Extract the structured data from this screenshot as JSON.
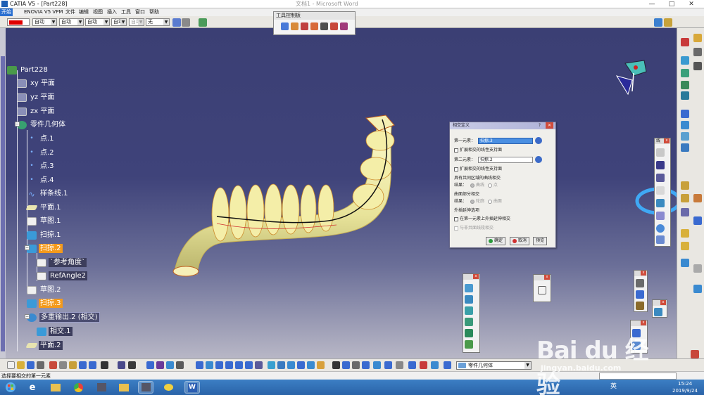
{
  "window": {
    "title": "CATIA V5 - [Part228]",
    "background_title": "文档1 - Microsoft Word",
    "controls": [
      "—",
      "□",
      "✕"
    ]
  },
  "menubar": {
    "items": [
      "开始",
      "ENOVIA V5 VPM",
      "文件",
      "编辑",
      "视图",
      "插入",
      "工具",
      "窗口",
      "帮助"
    ]
  },
  "top_toolbar": {
    "color": "#e00000",
    "combos": [
      "自动",
      "自动",
      "自动",
      "自动",
      "自动",
      "无"
    ]
  },
  "toolbox": {
    "title": "工具控制板"
  },
  "tree": {
    "root": "Part228",
    "items": [
      {
        "label": "xy 平面",
        "icon": "plane-icon"
      },
      {
        "label": "yz 平面",
        "icon": "plane-icon"
      },
      {
        "label": "zx 平面",
        "icon": "plane-icon"
      },
      {
        "label": "零件几何体",
        "icon": "body-icon"
      },
      {
        "label": "点.1",
        "icon": "point-icon"
      },
      {
        "label": "点.2",
        "icon": "point-icon"
      },
      {
        "label": "点.3",
        "icon": "point-icon"
      },
      {
        "label": "点.4",
        "icon": "point-icon"
      },
      {
        "label": "样条线.1",
        "icon": "spline-icon"
      },
      {
        "label": "平面.1",
        "icon": "plane-feature-icon"
      },
      {
        "label": "草图.1",
        "icon": "sketch-icon"
      },
      {
        "label": "扫掠.1",
        "icon": "sweep-icon"
      },
      {
        "label": "扫掠.2",
        "icon": "sweep-icon"
      },
      {
        "label": "`参考角度`",
        "icon": "parameter-icon"
      },
      {
        "label": "RefAngle2",
        "icon": "parameter-icon"
      },
      {
        "label": "草图.2",
        "icon": "sketch-icon"
      },
      {
        "label": "扫掠.3",
        "icon": "sweep-icon"
      },
      {
        "label": "多重输出.2 (相交)",
        "icon": "multi-output-icon"
      },
      {
        "label": "相交.1",
        "icon": "intersect-icon"
      },
      {
        "label": "平面.2",
        "icon": "plane-feature-icon"
      }
    ]
  },
  "dialog": {
    "title": "相交定义",
    "help": "?",
    "close": "✕",
    "first_element_label": "第一元素：",
    "first_element_value": "扫掠.3",
    "extend_first": "扩展相交的线性支持面",
    "second_element_label": "第二元素：",
    "second_element_value": "扫掠.2",
    "extend_second": "扩展相交的线性支持面",
    "section_common_curve": "具有共同区域的曲线相交",
    "result_label_1": "结果：",
    "result_opt_curve": "曲线",
    "result_opt_point": "点",
    "section_surface_part": "曲面部分相交",
    "result_label_2": "结果：",
    "result_opt_contour": "轮廓",
    "result_opt_surface": "曲面",
    "section_extrapolation": "外插延伸选项",
    "extrapolate_first": "在第一元素上外插延伸相交",
    "coplanar": "与非共面线段相交",
    "ok": "确定",
    "cancel": "取消",
    "preview": "预览"
  },
  "bottom_toolbar": {
    "current_body": "零件几何体"
  },
  "status": {
    "text": "选择要相交的第一元素"
  },
  "taskbar": {
    "time": "15:24",
    "date": "2019/9/24",
    "lang": "英"
  },
  "watermark": {
    "brand": "Bai du 经验",
    "url": "jingyan.baidu.com"
  },
  "side_labels": {
    "right_tb_cap": "线"
  }
}
